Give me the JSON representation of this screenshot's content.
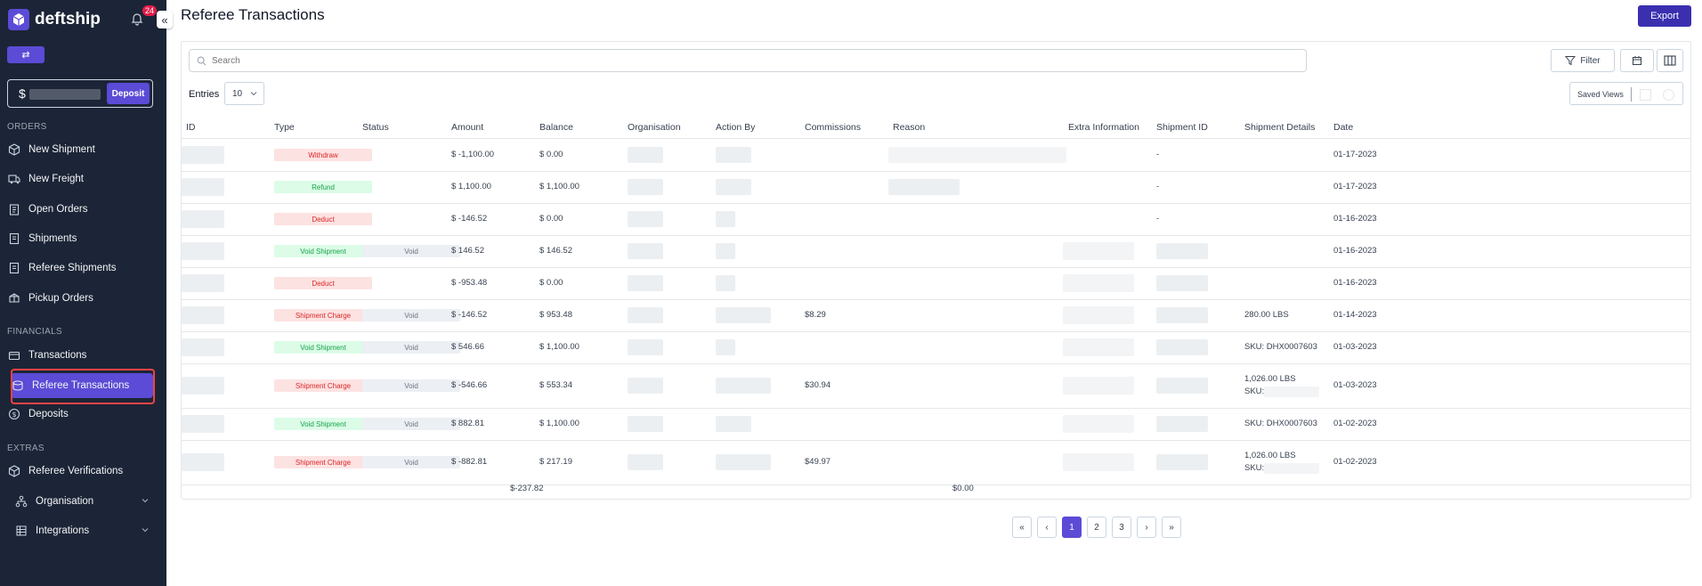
{
  "brand": {
    "name": "deftship",
    "notifications": "24"
  },
  "sidebar": {
    "collapse_glyph": "«",
    "switch_glyph": "⇄",
    "balance_currency": "$",
    "deposit_label": "Deposit",
    "sections": {
      "orders": "ORDERS",
      "financials": "FINANCIALS",
      "extras": "EXTRAS"
    },
    "items": {
      "new_shipment": "New Shipment",
      "new_freight": "New Freight",
      "open_orders": "Open Orders",
      "shipments": "Shipments",
      "referee_shipments": "Referee Shipments",
      "pickup_orders": "Pickup Orders",
      "transactions": "Transactions",
      "referee_transactions": "Referee Transactions",
      "deposits": "Deposits",
      "referee_verifications": "Referee Verifications",
      "organisation": "Organisation",
      "integrations": "Integrations"
    }
  },
  "header": {
    "title": "Referee Transactions",
    "export_label": "Export"
  },
  "toolbar": {
    "search_placeholder": "Search",
    "filter_label": "Filter",
    "entries_label": "Entries",
    "entries_value": "10",
    "saved_views_label": "Saved Views"
  },
  "table": {
    "columns": [
      "ID",
      "Type",
      "Status",
      "Amount",
      "Balance",
      "Organisation",
      "Action By",
      "Commissions",
      "Reason",
      "Extra Information",
      "Shipment ID",
      "Shipment Details",
      "Date"
    ],
    "rows": [
      {
        "type": "Withdraw",
        "type_color": "red",
        "status": "",
        "amount": "$ -1,100.00",
        "balance": "$ 0.00",
        "commissions": "",
        "shipment_id": "-",
        "details1": "",
        "details2": "",
        "date": "01-17-2023"
      },
      {
        "type": "Refund",
        "type_color": "green",
        "status": "",
        "amount": "$ 1,100.00",
        "balance": "$ 1,100.00",
        "commissions": "",
        "shipment_id": "-",
        "details1": "",
        "details2": "",
        "date": "01-17-2023"
      },
      {
        "type": "Deduct",
        "type_color": "red",
        "status": "",
        "amount": "$ -146.52",
        "balance": "$ 0.00",
        "commissions": "",
        "shipment_id": "-",
        "details1": "",
        "details2": "",
        "date": "01-16-2023"
      },
      {
        "type": "Void Shipment",
        "type_color": "green",
        "status": "Void",
        "amount": "$ 146.52",
        "balance": "$ 146.52",
        "commissions": "",
        "shipment_id": "",
        "details1": "",
        "details2": "",
        "date": "01-16-2023"
      },
      {
        "type": "Deduct",
        "type_color": "red",
        "status": "",
        "amount": "$ -953.48",
        "balance": "$ 0.00",
        "commissions": "",
        "shipment_id": "",
        "details1": "",
        "details2": "",
        "date": "01-16-2023"
      },
      {
        "type": "Shipment Charge",
        "type_color": "red",
        "status": "Void",
        "amount": "$ -146.52",
        "balance": "$ 953.48",
        "commissions": "$8.29",
        "shipment_id": "",
        "details1": "280.00 LBS",
        "details2": "",
        "date": "01-14-2023"
      },
      {
        "type": "Void Shipment",
        "type_color": "green",
        "status": "Void",
        "amount": "$ 546.66",
        "balance": "$ 1,100.00",
        "commissions": "",
        "shipment_id": "",
        "details1": "SKU: DHX0007603",
        "details2": "",
        "date": "01-03-2023"
      },
      {
        "type": "Shipment Charge",
        "type_color": "red",
        "status": "Void",
        "amount": "$ -546.66",
        "balance": "$ 553.34",
        "commissions": "$30.94",
        "shipment_id": "",
        "details1": "1,026.00 LBS",
        "details2": "SKU:",
        "date": "01-03-2023"
      },
      {
        "type": "Void Shipment",
        "type_color": "green",
        "status": "Void",
        "amount": "$ 882.81",
        "balance": "$ 1,100.00",
        "commissions": "",
        "shipment_id": "",
        "details1": "SKU: DHX0007603",
        "details2": "",
        "date": "01-02-2023"
      },
      {
        "type": "Shipment Charge",
        "type_color": "red",
        "status": "Void",
        "amount": "$ -882.81",
        "balance": "$ 217.19",
        "commissions": "$49.97",
        "shipment_id": "",
        "details1": "1,026.00 LBS",
        "details2": "SKU:",
        "date": "01-02-2023"
      }
    ],
    "totals": {
      "amount": "$-237.82",
      "commissions": "$0.00"
    }
  },
  "pagination": {
    "first": "«",
    "prev": "‹",
    "pages": [
      "1",
      "2",
      "3"
    ],
    "next": "›",
    "last": "»",
    "current": "1"
  },
  "colors": {
    "sidebar_bg": "#1c2537",
    "accent": "#5b4bd6",
    "export": "#3b2fb0",
    "highlight": "#ef4444"
  }
}
